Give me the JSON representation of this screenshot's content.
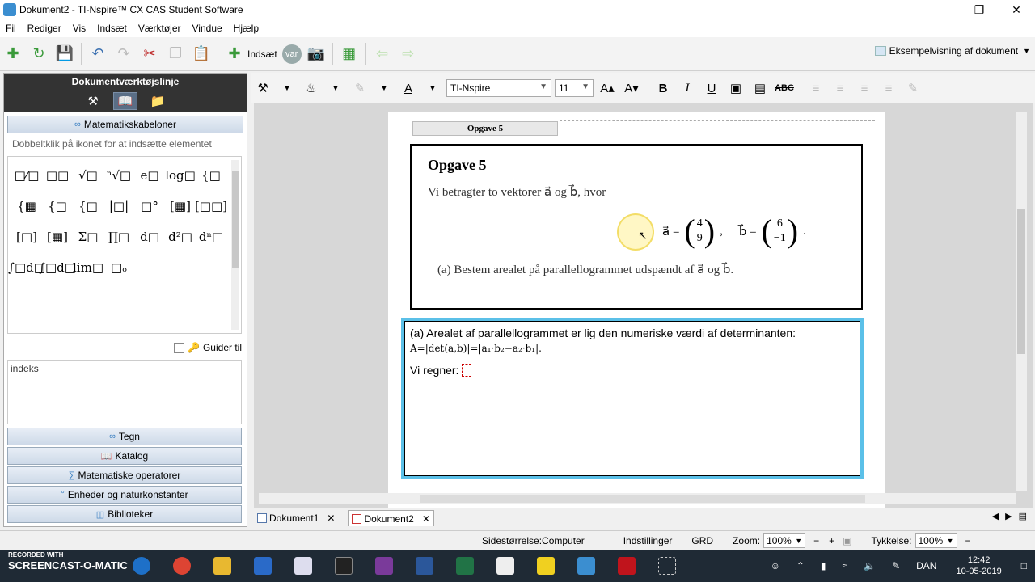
{
  "window": {
    "title": "Dokument2 - TI-Nspire™ CX CAS Student Software",
    "minimize": "—",
    "maximize": "❐",
    "close": "✕"
  },
  "menu": [
    "Fil",
    "Rediger",
    "Vis",
    "Indsæt",
    "Værktøjer",
    "Vindue",
    "Hjælp"
  ],
  "toolbar": {
    "insert_label": "Indsæt",
    "var_label": "var",
    "preview_label": "Eksempelvisning af dokument"
  },
  "left_panel": {
    "header": "Dokumentværktøjslinje",
    "section_title": "Matematikskabeloner",
    "hint": "Dobbeltklik på ikonet for at indsætte elementet",
    "templates": [
      "□⁄□",
      "□□",
      "√□",
      "ⁿ√□",
      "e□",
      "log□",
      "{□",
      "{▦",
      "{□",
      "{□",
      "|□|",
      "□°",
      "[▦]",
      "[□□]",
      "[□]",
      "[▦]",
      "Σ□",
      "∏□",
      "d□",
      "d²□",
      "dⁿ□",
      "∫□d□",
      "∫□d□",
      "lim□",
      "□ₒ"
    ],
    "guider_label": "Guider til",
    "index_label": "indeks",
    "bottom_sections": [
      "Tegn",
      "Katalog",
      "Matematiske operatorer",
      "Enheder og naturkonstanter",
      "Biblioteker"
    ]
  },
  "format_bar": {
    "font": "TI-Nspire",
    "size": "11",
    "bold": "B",
    "italic": "I",
    "underline": "U",
    "strike": "ABC"
  },
  "document": {
    "page_label": "Opgave 5",
    "problem": {
      "title": "Opgave 5",
      "intro": "Vi betragter to vektorer a⃗ og b⃗, hvor",
      "vec_a_label": "a⃗ =",
      "vec_a": [
        "4",
        "9"
      ],
      "vec_b_label": "b⃗ =",
      "vec_b": [
        "6",
        "−1"
      ],
      "question": "(a)  Bestem arealet på parallellogrammet udspændt af a⃗ og b⃗."
    },
    "answer": {
      "line1": "(a) Arealet af parallellogrammet er lig den numeriske værdi af determinanten:",
      "formula": "A=|det(a,b)|=|a₁·b₂−a₂·b₁|.",
      "line2": "Vi regner:"
    }
  },
  "tabs": [
    {
      "label": "Dokument1",
      "close": "✕"
    },
    {
      "label": "Dokument2",
      "close": "✕"
    }
  ],
  "status": {
    "page_size": "Sidestørrelse:Computer",
    "settings": "Indstillinger",
    "grd": "GRD",
    "zoom_label": "Zoom:",
    "zoom_value": "100%",
    "thickness_label": "Tykkelse:",
    "thickness_value": "100%"
  },
  "taskbar": {
    "recorded": "RECORDED WITH",
    "brand": "SCREENCAST-O-MATIC",
    "lang": "DAN",
    "time": "12:42",
    "date": "10-05-2019"
  }
}
